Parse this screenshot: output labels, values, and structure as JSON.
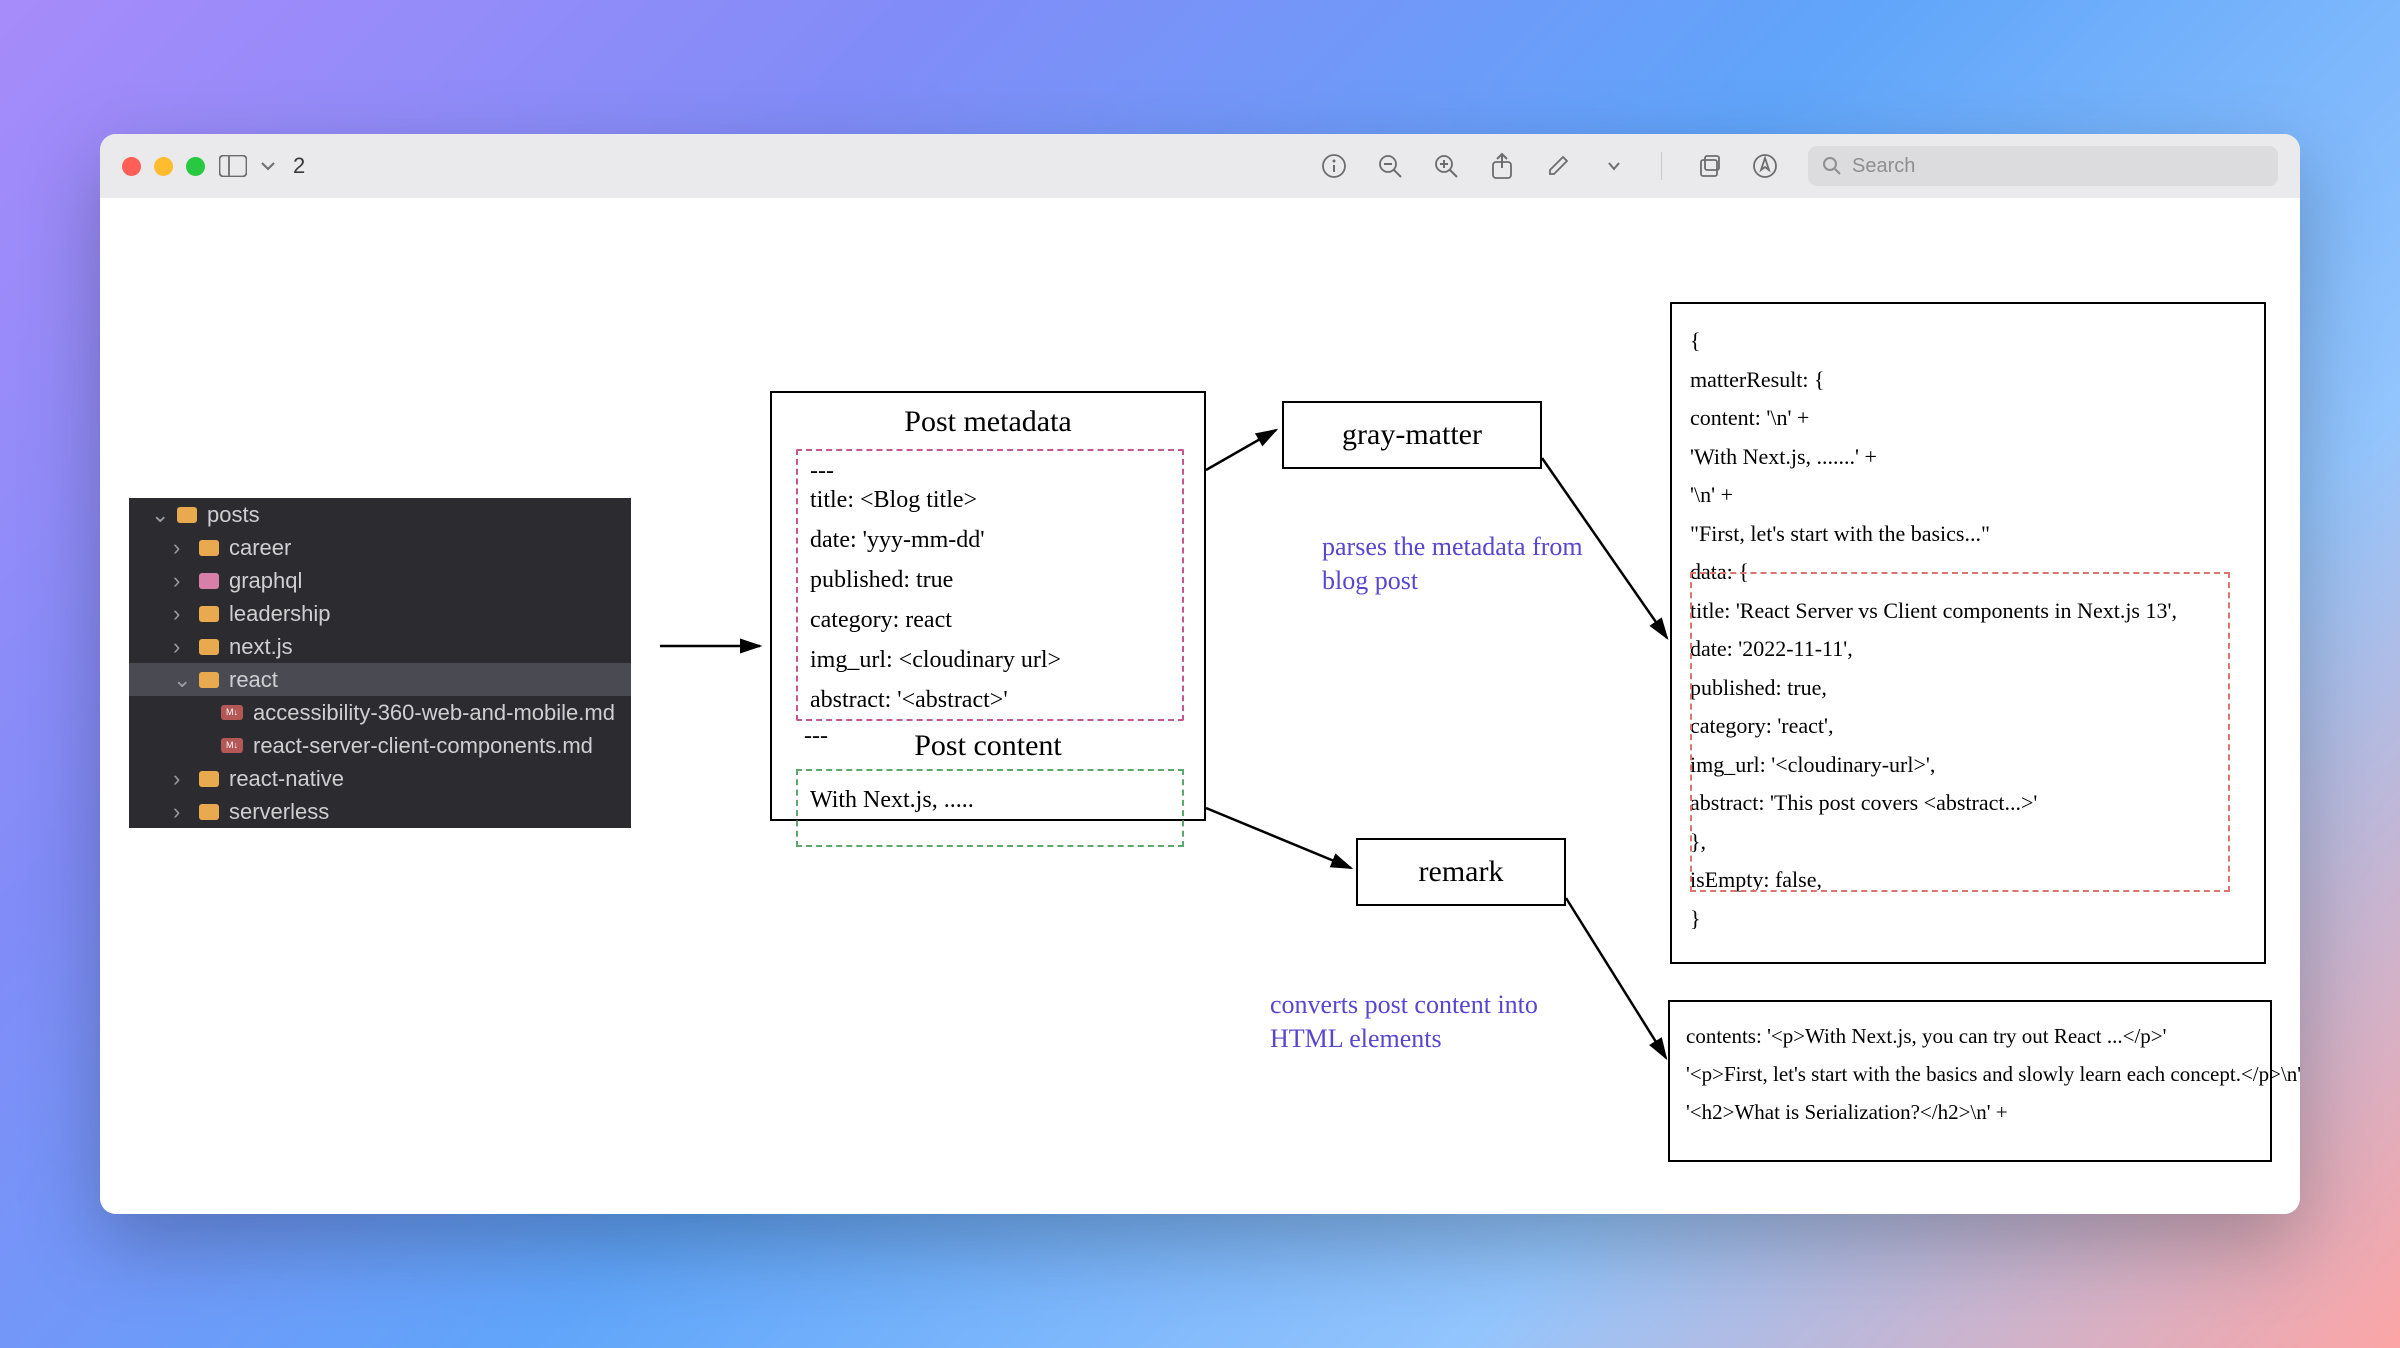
{
  "titlebar": {
    "title": "2",
    "search_placeholder": "Search"
  },
  "filetree": {
    "posts": "posts",
    "career": "career",
    "graphql": "graphql",
    "leadership": "leadership",
    "nextjs": "next.js",
    "react": "react",
    "file1": "accessibility-360-web-and-mobile.md",
    "file2": "react-server-client-components.md",
    "react_native": "react-native",
    "serverless": "serverless"
  },
  "post": {
    "metadata_title": "Post metadata",
    "sep_top": "---",
    "line_title": "title: <Blog title>",
    "line_date": "date: 'yyy-mm-dd'",
    "line_published": "published: true",
    "line_category": "category: react",
    "line_imgurl": "img_url: <cloudinary url>",
    "line_abstract": "abstract: '<abstract>'",
    "sep_bot": "---",
    "content_title": "Post content",
    "content_line": "With Next.js, ....."
  },
  "libs": {
    "gray_matter": "gray-matter",
    "remark": "remark"
  },
  "annotations": {
    "gray_matter": "parses the metadata from blog post",
    "remark": "converts post content into HTML elements"
  },
  "json": {
    "l1": "{",
    "l2": "matterResult: {",
    "l3": "content: '\\n' +",
    "l4": "'With Next.js, .......' +",
    "l5": "'\\n' +",
    "l6": "\"First, let's start with the basics...\"",
    "l7": "data: {",
    "l8": "title: 'React Server vs Client components in Next.js 13',",
    "l9": "date: '2022-11-11',",
    "l10": "published: true,",
    "l11": "category: 'react',",
    "l12": "img_url: '<cloudinary-url>',",
    "l13": "abstract: 'This post covers <abstract...>'",
    "l14": "},",
    "l15": "isEmpty: false,",
    "l16": "}"
  },
  "html": {
    "l1": "contents: '<p>With Next.js, you can try out React ...</p>'",
    "l2": "'<p>First, let's start with the basics and slowly learn each concept.</p>\\n' +",
    "l3": "'<h2>What is Serialization?</h2>\\n' +"
  }
}
